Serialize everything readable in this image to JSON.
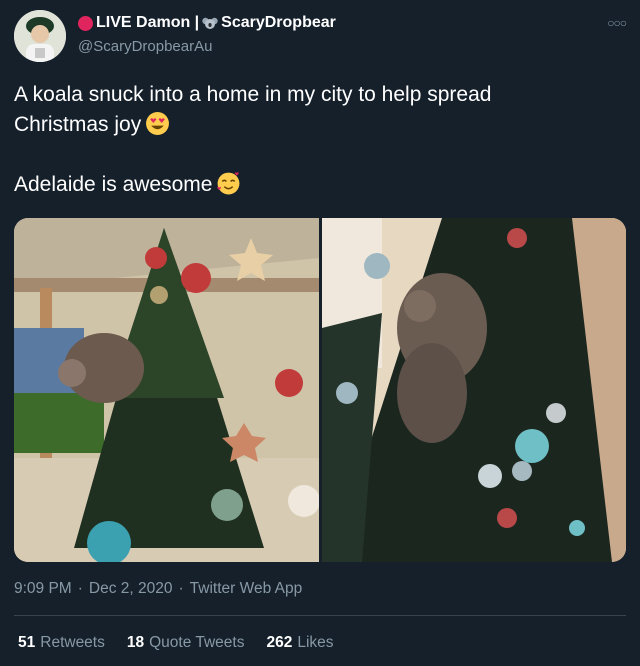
{
  "author": {
    "display_name_live": "LIVE Damon |",
    "display_name_suffix": "ScaryDropbear",
    "handle": "@ScaryDropbearAu"
  },
  "tweet": {
    "line1": "A koala snuck into a home in my city to help spread",
    "line2": "Christmas joy",
    "line3": "Adelaide is awesome"
  },
  "meta": {
    "time": "9:09 PM",
    "sep1": "·",
    "date": "Dec 2, 2020",
    "sep2": "·",
    "source": "Twitter Web App"
  },
  "stats": {
    "retweets_count": "51",
    "retweets_label": "Retweets",
    "quotes_count": "18",
    "quotes_label": "Quote Tweets",
    "likes_count": "262",
    "likes_label": "Likes"
  },
  "icons": {
    "more": "more-icon",
    "emoji1": "heart-eyes-emoji",
    "emoji2": "smiling-face-with-hearts-emoji",
    "live_dot": "red-dot",
    "koala": "koala-icon"
  },
  "colors": {
    "background": "#15202b",
    "secondary_text": "#8899a6",
    "divider": "#38444d"
  }
}
